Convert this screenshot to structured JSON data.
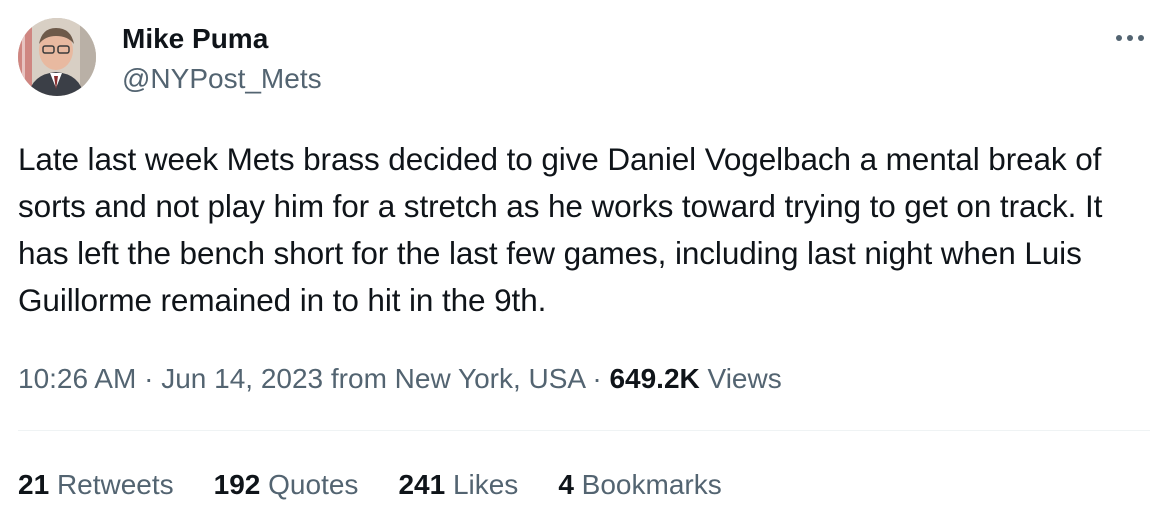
{
  "author": {
    "name": "Mike Puma",
    "handle": "@NYPost_Mets",
    "avatar_icon": "profile-photo"
  },
  "more_icon": "ellipsis-icon",
  "tweet": {
    "text": "Late last week Mets brass decided to give Daniel Vogelbach a mental break of sorts and not play him for a stretch as he works toward trying to get on track. It has left the bench short for the last few games, including last night when Luis Guillorme remained in to hit in the 9th."
  },
  "meta": {
    "time": "10:26 AM",
    "separator": "·",
    "date": "Jun 14, 2023",
    "location": "from New York, USA",
    "views_count": "649.2K",
    "views_label": "Views"
  },
  "stats": {
    "retweets": {
      "count": "21",
      "label": "Retweets"
    },
    "quotes": {
      "count": "192",
      "label": "Quotes"
    },
    "likes": {
      "count": "241",
      "label": "Likes"
    },
    "bookmarks": {
      "count": "4",
      "label": "Bookmarks"
    }
  },
  "colors": {
    "text_primary": "#0f1419",
    "text_secondary": "#536471",
    "divider": "#eff3f4",
    "background": "#ffffff"
  }
}
